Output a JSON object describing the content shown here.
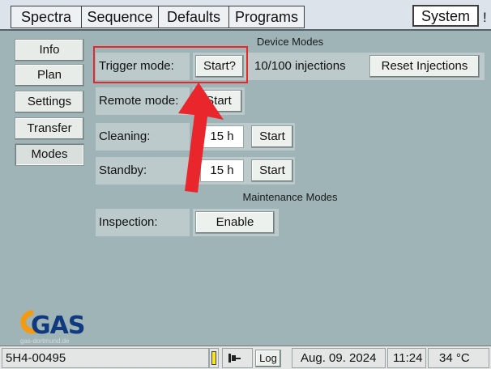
{
  "tabs": {
    "spectra": "Spectra",
    "sequence": "Sequence",
    "defaults": "Defaults",
    "programs": "Programs",
    "system": "System",
    "overflow": "!"
  },
  "sidebar": {
    "items": [
      {
        "label": "Info"
      },
      {
        "label": "Plan"
      },
      {
        "label": "Settings"
      },
      {
        "label": "Transfer"
      },
      {
        "label": "Modes"
      }
    ],
    "active": "Modes"
  },
  "device_modes": {
    "title": "Device Modes",
    "trigger": {
      "label": "Trigger mode:",
      "button": "Start?",
      "status": "10/100 injections",
      "reset": "Reset Injections"
    },
    "remote": {
      "label": "Remote mode:",
      "button": "Start"
    },
    "cleaning": {
      "label": "Cleaning:",
      "hours": "15 h",
      "button": "Start"
    },
    "standby": {
      "label": "Standby:",
      "hours": "15 h",
      "button": "Start"
    }
  },
  "maintenance_modes": {
    "title": "Maintenance Modes",
    "inspection": {
      "label": "Inspection:",
      "button": "Enable"
    }
  },
  "logo": {
    "text": "GAS",
    "sub": "gas-dortmund.de"
  },
  "status": {
    "device_id": "5H4-00495",
    "log": "Log",
    "date": "Aug. 09. 2024",
    "time": "11:24",
    "temperature": "34 °C"
  },
  "colors": {
    "background": "#9fb4b6",
    "highlight": "#e8262b",
    "logo_blue": "#10397e",
    "logo_orange": "#f39a12"
  }
}
